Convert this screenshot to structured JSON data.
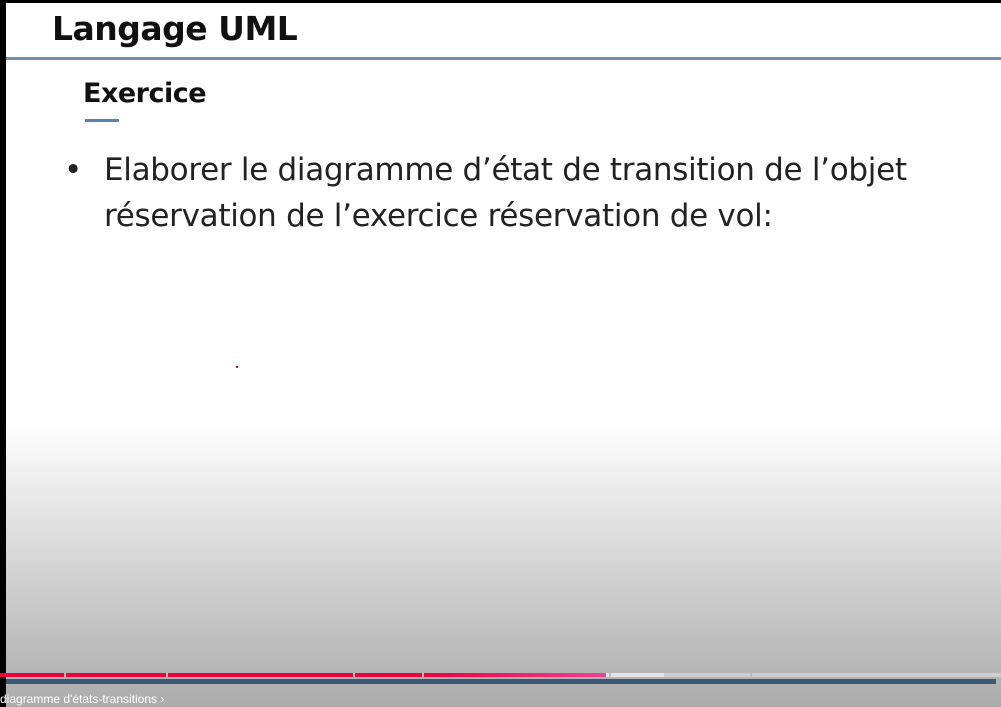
{
  "slide": {
    "title": "Langage UML",
    "subtitle": "Exercice",
    "bullet_symbol": "•",
    "bullet_text": "Elaborer le diagramme d’état de transition de l’objet réservation de l’exercice réservation de vol:"
  },
  "player": {
    "progress_percent": 60.5,
    "buffered_percent": 66.3,
    "chapter_title": "diagramme d'états-transitions",
    "chapter_chevron": "›",
    "progress_color": "#f0003a",
    "accent_color": "#6f8fb5"
  }
}
